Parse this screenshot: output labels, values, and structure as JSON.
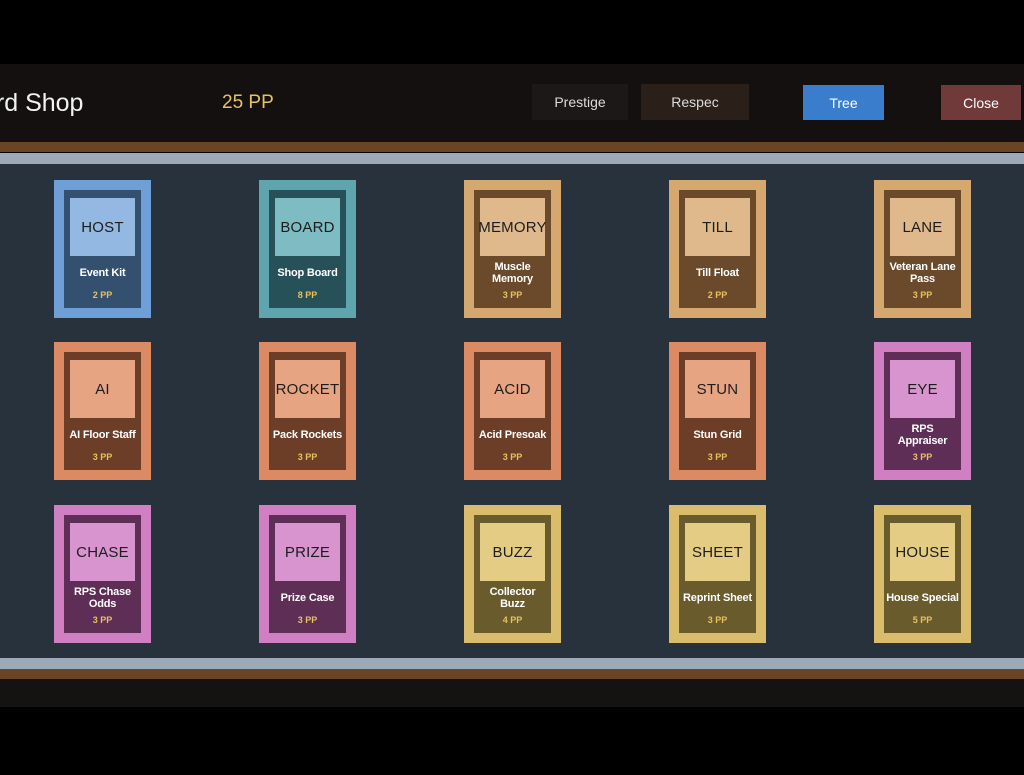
{
  "header": {
    "title": "ard Shop",
    "points": "25 PP"
  },
  "buttons": {
    "prestige": "Prestige",
    "respec": "Respec",
    "tree": "Tree",
    "close": "Close"
  },
  "cards": [
    {
      "tag": "HOST",
      "name": "Event Kit",
      "cost": "2 PP",
      "theme": "blue"
    },
    {
      "tag": "BOARD",
      "name": "Shop Board",
      "cost": "8 PP",
      "theme": "teal"
    },
    {
      "tag": "MEMORY",
      "name": "Muscle Memory",
      "cost": "3 PP",
      "theme": "tan"
    },
    {
      "tag": "TILL",
      "name": "Till Float",
      "cost": "2 PP",
      "theme": "tan"
    },
    {
      "tag": "LANE",
      "name": "Veteran Lane Pass",
      "cost": "3 PP",
      "theme": "tan"
    },
    {
      "tag": "AI",
      "name": "AI Floor Staff",
      "cost": "3 PP",
      "theme": "orange"
    },
    {
      "tag": "ROCKET",
      "name": "Pack Rockets",
      "cost": "3 PP",
      "theme": "orange"
    },
    {
      "tag": "ACID",
      "name": "Acid Presoak",
      "cost": "3 PP",
      "theme": "orange"
    },
    {
      "tag": "STUN",
      "name": "Stun Grid",
      "cost": "3 PP",
      "theme": "orange"
    },
    {
      "tag": "EYE",
      "name": "RPS Appraiser",
      "cost": "3 PP",
      "theme": "pink"
    },
    {
      "tag": "CHASE",
      "name": "RPS Chase Odds",
      "cost": "3 PP",
      "theme": "pink"
    },
    {
      "tag": "PRIZE",
      "name": "Prize Case",
      "cost": "3 PP",
      "theme": "pink"
    },
    {
      "tag": "BUZZ",
      "name": "Collector Buzz",
      "cost": "4 PP",
      "theme": "gold"
    },
    {
      "tag": "SHEET",
      "name": "Reprint Sheet",
      "cost": "3 PP",
      "theme": "gold"
    },
    {
      "tag": "HOUSE",
      "name": "House Special",
      "cost": "5 PP",
      "theme": "gold"
    }
  ],
  "themes": {
    "blue": {
      "frame": "#6e9fd6",
      "inner": "#33506f",
      "art": "#93b8e2"
    },
    "teal": {
      "frame": "#5fa5ad",
      "inner": "#275159",
      "art": "#7dbcc2"
    },
    "tan": {
      "frame": "#d5a86f",
      "inner": "#6a4a2b",
      "art": "#dfb98b"
    },
    "orange": {
      "frame": "#dc8a64",
      "inner": "#6c3d27",
      "art": "#e7a483"
    },
    "pink": {
      "frame": "#cf7fc2",
      "inner": "#5f2e56",
      "art": "#d894cf"
    },
    "gold": {
      "frame": "#d9bd6c",
      "inner": "#6a5b2d",
      "art": "#e5cc85"
    }
  }
}
